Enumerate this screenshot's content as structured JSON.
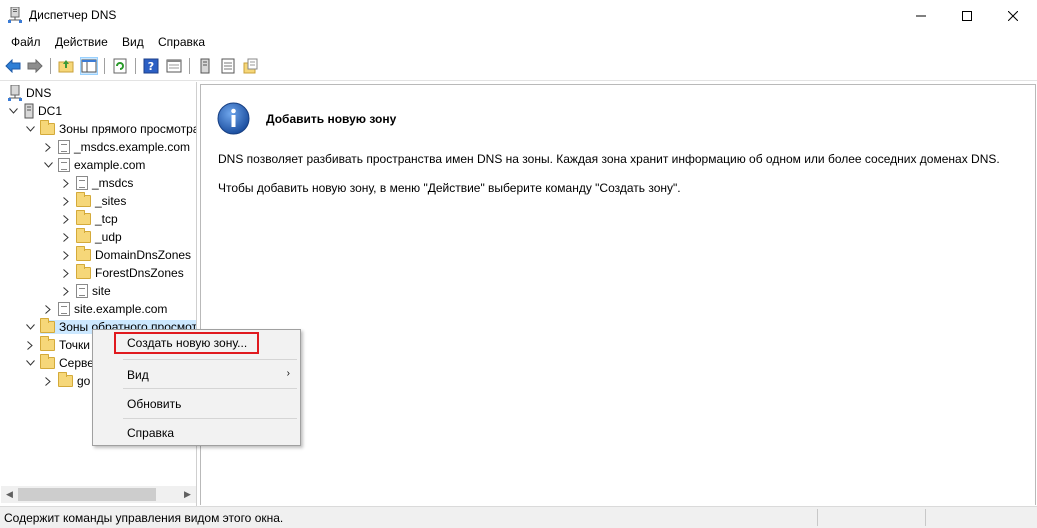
{
  "window": {
    "title": "Диспетчер DNS",
    "controls": {
      "minimize": "—",
      "maximize": "☐",
      "close": "✕"
    }
  },
  "menubar": [
    "Файл",
    "Действие",
    "Вид",
    "Справка"
  ],
  "toolbar": {
    "icons": [
      "back-arrow-icon",
      "forward-arrow-icon",
      "up-folder-icon",
      "console-tree-icon",
      "refresh-icon",
      "help-icon",
      "properties-icon",
      "server-icon",
      "list-icon",
      "new-zone-icon"
    ]
  },
  "tree": {
    "root": "DNS",
    "server": "DC1",
    "forward_zones": "Зоны прямого просмотра",
    "msdcs_zone": "_msdcs.example.com",
    "example_zone": "example.com",
    "sub_msdcs": "_msdcs",
    "sub_sites": "_sites",
    "sub_tcp": "_tcp",
    "sub_udp": "_udp",
    "sub_domaindns": "DomainDnsZones",
    "sub_forestdns": "ForestDnsZones",
    "sub_site": "site",
    "site_zone": "site.example.com",
    "reverse_zones": "Зоны обратного просмотра",
    "trust_points": "Точки",
    "forwarders": "Серве",
    "forwarder_child": "go"
  },
  "right_pane": {
    "heading": "Добавить новую зону",
    "text1": "DNS позволяет разбивать пространства имен DNS на зоны. Каждая зона хранит информацию об одном или более соседних доменах DNS.",
    "text2": "Чтобы добавить новую зону, в меню \"Действие\" выберите команду \"Создать зону\"."
  },
  "context_menu": {
    "create_zone": "Создать новую зону...",
    "view": "Вид",
    "refresh": "Обновить",
    "help": "Справка"
  },
  "statusbar": {
    "text": "Содержит команды управления видом этого окна."
  }
}
